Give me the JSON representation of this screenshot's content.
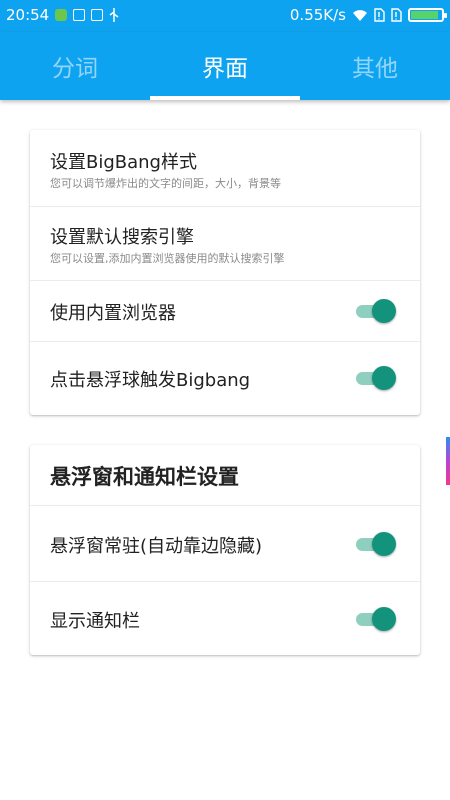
{
  "status_bar": {
    "time": "20:54",
    "net_speed": "0.55K/s",
    "icons_left": [
      "app-notify-icon",
      "file-icon",
      "screenshot-icon",
      "usb-icon"
    ],
    "icons_right": [
      "wifi-icon",
      "no-sim-icon",
      "no-sim-icon",
      "battery-icon"
    ],
    "battery_level": 0.9,
    "battery_color": "#58d26a"
  },
  "tabs": [
    {
      "label": "分词",
      "active": false
    },
    {
      "label": "界面",
      "active": true
    },
    {
      "label": "其他",
      "active": false
    }
  ],
  "colors": {
    "primary": "#0EA3F0",
    "switch_on": "#13937c",
    "switch_track": "#8fcfc0"
  },
  "card1": {
    "items": [
      {
        "title": "设置BigBang样式",
        "subtitle": "您可以调节爆炸出的文字的间距，大小，背景等"
      },
      {
        "title": "设置默认搜索引擎",
        "subtitle": "您可以设置,添加内置浏览器使用的默认搜索引擎"
      },
      {
        "title": "使用内置浏览器",
        "switch_on": true
      },
      {
        "title": "点击悬浮球触发Bigbang",
        "switch_on": true
      }
    ]
  },
  "card2": {
    "section_title": "悬浮窗和通知栏设置",
    "items": [
      {
        "title": "悬浮窗常驻(自动靠边隐藏)",
        "switch_on": true
      },
      {
        "title": "显示通知栏",
        "switch_on": true
      }
    ]
  }
}
